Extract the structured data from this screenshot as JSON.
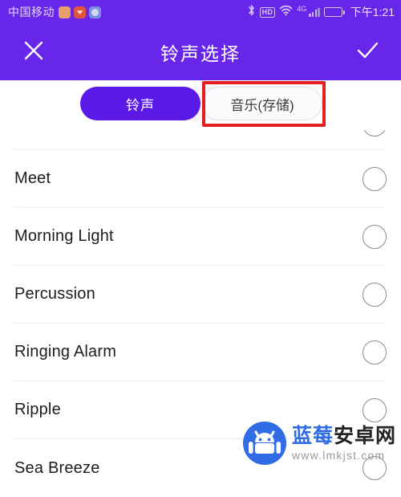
{
  "status_bar": {
    "carrier": "中国移动",
    "notification_icons": [
      "app-notification-orange-icon",
      "app-notification-heart-icon",
      "app-notification-blue-icon"
    ],
    "bluetooth_icon": "bluetooth-icon",
    "hd_label": "HD",
    "wifi_icon": "wifi-icon",
    "network_type": "4G",
    "signal_icon": "cellular-signal-icon",
    "battery_icon": "battery-icon",
    "time": "下午1:21"
  },
  "app_bar": {
    "close_icon": "close-icon",
    "title": "铃声选择",
    "confirm_icon": "check-icon"
  },
  "tabs": [
    {
      "label": "铃声",
      "active": true
    },
    {
      "label": "音乐(存储)",
      "active": false
    }
  ],
  "annotation": {
    "target": "音乐(存储)",
    "color": "#e31f1f"
  },
  "ringtones": [
    {
      "name": "Meet",
      "selected": false
    },
    {
      "name": "Morning Light",
      "selected": false
    },
    {
      "name": "Percussion",
      "selected": false
    },
    {
      "name": "Ringing Alarm",
      "selected": false
    },
    {
      "name": "Ripple",
      "selected": false
    },
    {
      "name": "Sea Breeze",
      "selected": false
    }
  ],
  "watermark": {
    "brand_blue": "蓝莓",
    "brand_dark": "安卓网",
    "url": "www.lmkjst.com",
    "logo_icon": "android-robot-icon"
  },
  "colors": {
    "primary_purple": "#6826EA",
    "tab_active_purple": "#5b19e8",
    "annotation_red": "#e31f1f",
    "watermark_blue": "#2f6ce5"
  }
}
